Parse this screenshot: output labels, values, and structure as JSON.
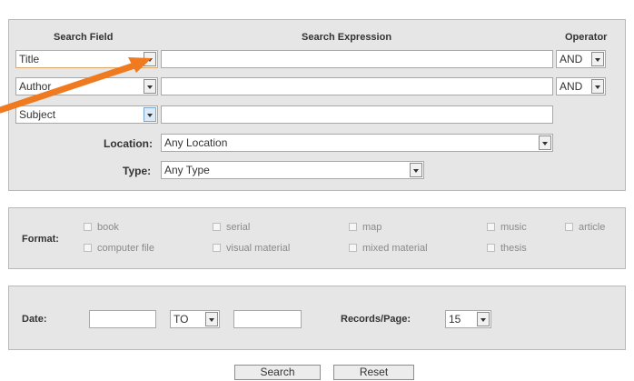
{
  "headers": {
    "search_field": "Search Field",
    "search_expression": "Search Expression",
    "operator": "Operator"
  },
  "rows": [
    {
      "field": "Title",
      "operator": "AND"
    },
    {
      "field": "Author",
      "operator": "AND"
    },
    {
      "field": "Subject"
    }
  ],
  "location": {
    "label": "Location:",
    "value": "Any Location"
  },
  "type": {
    "label": "Type:",
    "value": "Any Type"
  },
  "format": {
    "label": "Format:",
    "options": [
      "book",
      "serial",
      "map",
      "music",
      "article",
      "computer file",
      "visual material",
      "mixed material",
      "thesis"
    ]
  },
  "date": {
    "label": "Date:",
    "range_operator": "TO",
    "records_label": "Records/Page:",
    "records_value": "15"
  },
  "buttons": {
    "search": "Search",
    "reset": "Reset"
  },
  "annotation": {
    "arrow_color": "#ef7a1f"
  }
}
